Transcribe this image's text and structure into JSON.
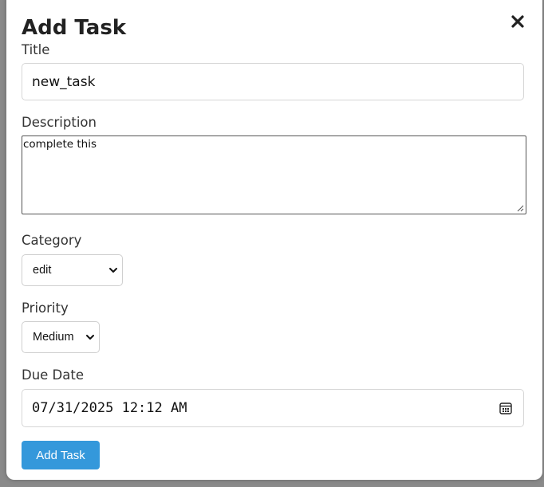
{
  "modal": {
    "title": "Add Task",
    "close_icon": "close-icon"
  },
  "form": {
    "title_label": "Title",
    "title_value": "new_task",
    "description_label": "Description",
    "description_value": "complete this",
    "category_label": "Category",
    "category_value": "edit",
    "priority_label": "Priority",
    "priority_value": "Medium",
    "due_date_label": "Due Date",
    "due_date_value": "07/31/2025 12:12 AM",
    "submit_label": "Add Task"
  },
  "icons": {
    "close": "close-icon",
    "calendar": "calendar-icon",
    "chevron": "chevron-down-icon"
  },
  "colors": {
    "primary": "#3498db",
    "backdrop": "#8a8a8a"
  }
}
